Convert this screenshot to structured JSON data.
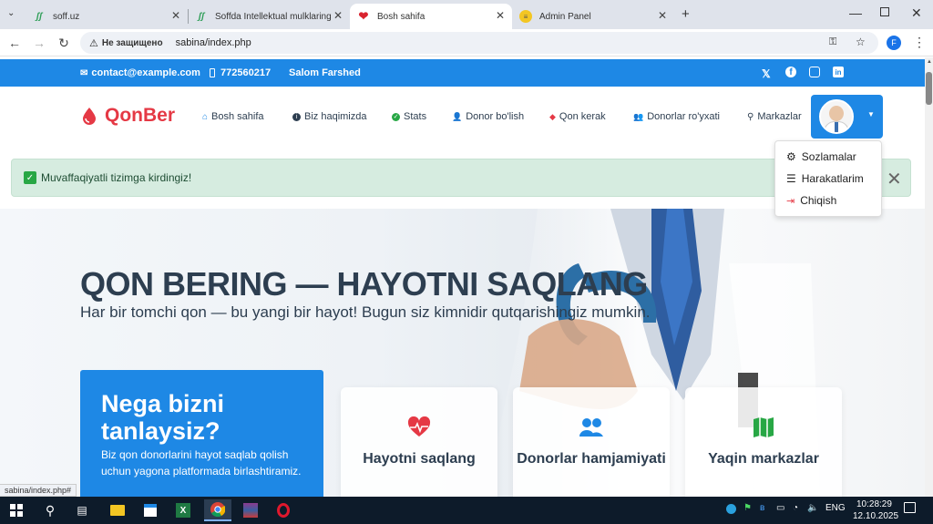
{
  "browser": {
    "tabs": [
      {
        "title": "soff.uz",
        "icon": "soff-icon",
        "active": false
      },
      {
        "title": "Soffda Intellektual mulklaringiz",
        "icon": "soff-icon",
        "active": false
      },
      {
        "title": "Bosh sahifa",
        "icon": "heart-icon",
        "active": true
      },
      {
        "title": "Admin Panel",
        "icon": "admin-icon",
        "active": false
      }
    ],
    "security_label": "Не защищено",
    "url": "sabina/index.php",
    "profile_initial": "F"
  },
  "topbar": {
    "email": "contact@example.com",
    "phone": "772560217",
    "greeting": "Salom Farshed"
  },
  "navbar": {
    "logo": "QonBer",
    "links": [
      "Bosh sahifa",
      "Biz haqimizda",
      "Stats",
      "Donor bo'lish",
      "Qon kerak",
      "Donorlar ro'yxati",
      "Markazlar"
    ]
  },
  "dropdown": {
    "items": [
      "Sozlamalar",
      "Harakatlarim",
      "Chiqish"
    ]
  },
  "alert": {
    "message": "Muvaffaqiyatli tizimga kirdingiz!"
  },
  "hero": {
    "title": "QON BERING — HAYOTNI SAQLANG",
    "subtitle": "Har bir tomchi qon — bu yangi bir hayot! Bugun siz kimnidir qutqarishingiz mumkin.",
    "why_title": "Nega bizni tanlaysiz?",
    "why_text": "Biz qon donorlarini hayot saqlab qolish uchun yagona platformada birlashtiramiz.",
    "cards": [
      "Hayotni saqlang",
      "Donorlar hamjamiyati",
      "Yaqin markazlar"
    ]
  },
  "status_link": "sabina/index.php#",
  "taskbar": {
    "lang": "ENG",
    "time": "10:28:29",
    "date": "12.10.2025"
  },
  "colors": {
    "brand": "#e53945",
    "primary": "#1e88e5",
    "success_bg": "#d6ece0"
  }
}
